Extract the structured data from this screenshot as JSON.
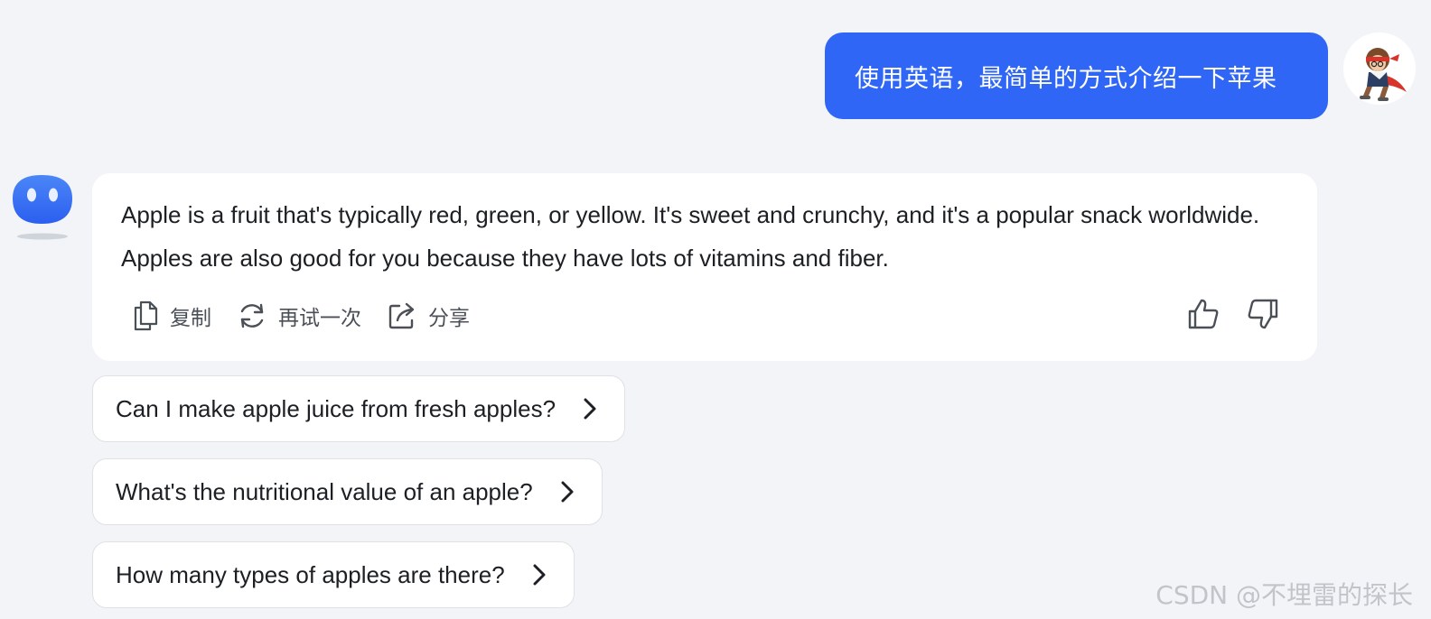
{
  "user_message": {
    "text": "使用英语，最简单的方式介绍一下苹果"
  },
  "bot_reply": {
    "text": "Apple is a fruit that's typically red, green, or yellow. It's sweet and crunchy, and it's a popular snack worldwide. Apples are also good for you because they have lots of vitamins and fiber.",
    "actions": [
      {
        "label": "复制",
        "icon": "copy-icon"
      },
      {
        "label": "再试一次",
        "icon": "refresh-icon"
      },
      {
        "label": "分享",
        "icon": "share-icon"
      }
    ],
    "feedback": {
      "like_icon": "thumbs-up-icon",
      "dislike_icon": "thumbs-down-icon"
    }
  },
  "suggestions": [
    "Can I make apple juice from fresh apples?",
    "What's the nutritional value of an apple?",
    "How many types of apples are there?"
  ],
  "watermark": "CSDN @不埋雷的探长",
  "colors": {
    "accent": "#2f66f5",
    "background": "#f3f4f8",
    "card": "#ffffff",
    "text": "#1c1f23",
    "muted": "#4b4f56"
  }
}
